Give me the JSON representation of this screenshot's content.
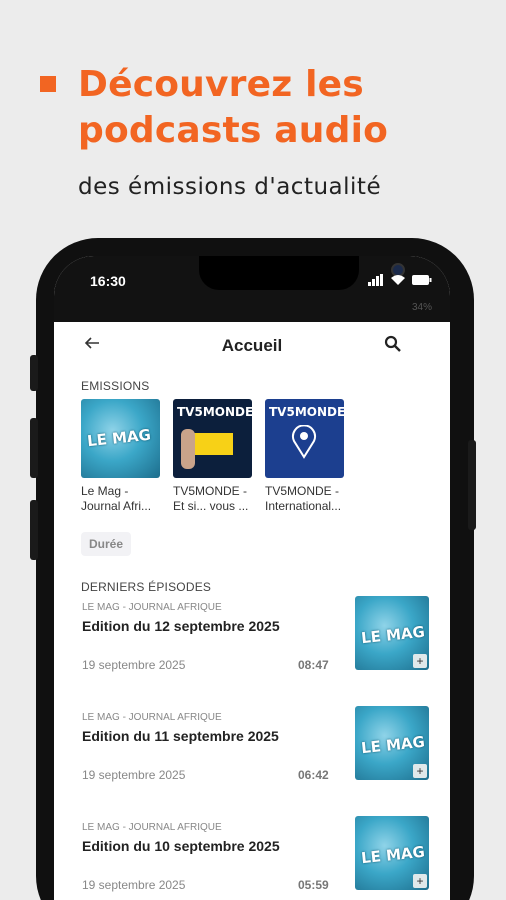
{
  "promo": {
    "headline_line1": "Découvrez les",
    "headline_line2": "podcasts audio",
    "subline": "des émissions  d'actualité",
    "accent_color": "#f26522"
  },
  "status_bar": {
    "time": "16:30",
    "secondary": "34%"
  },
  "app_bar": {
    "title": "Accueil",
    "back_icon": "arrow-left-icon",
    "search_icon": "search-icon"
  },
  "emissions": {
    "label": "EMISSIONS",
    "items": [
      {
        "name_line1": "Le Mag -",
        "name_line2": "Journal Afri...",
        "thumb_text": "LE MAG"
      },
      {
        "name_line1": "TV5MONDE -",
        "name_line2": "Et si... vous ...",
        "thumb_text": "TV5MONDE"
      },
      {
        "name_line1": "TV5MONDE -",
        "name_line2": "International...",
        "thumb_text": "TV5MONDE"
      }
    ]
  },
  "filter_chip": "Durée",
  "episodes": {
    "label": "DERNIERS ÉPISODES",
    "items": [
      {
        "show": "LE MAG - JOURNAL AFRIQUE",
        "title": "Edition du 12 septembre 2025",
        "date": "19 septembre 2025",
        "duration": "08:47"
      },
      {
        "show": "LE MAG - JOURNAL AFRIQUE",
        "title": "Edition du 11 septembre 2025",
        "date": "19 septembre 2025",
        "duration": "06:42"
      },
      {
        "show": "LE MAG - JOURNAL AFRIQUE",
        "title": "Edition du 10 septembre 2025",
        "date": "19 septembre 2025",
        "duration": "05:59"
      }
    ]
  }
}
